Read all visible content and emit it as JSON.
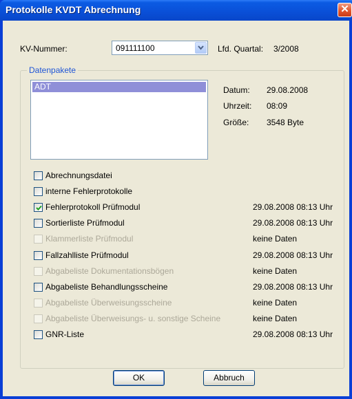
{
  "window": {
    "title": "Protokolle KVDT Abrechnung",
    "close_symbol": "✕"
  },
  "header": {
    "kv_label": "KV-Nummer:",
    "kv_value": "091111100",
    "quarter_label": "Lfd. Quartal:",
    "quarter_value": "3/2008"
  },
  "group": {
    "legend": "Datenpakete"
  },
  "list": {
    "items": [
      "ADT"
    ]
  },
  "details": {
    "date_label": "Datum:",
    "date_value": "29.08.2008",
    "time_label": "Uhrzeit:",
    "time_value": "08:09",
    "size_label": "Größe:",
    "size_value": "3548 Byte"
  },
  "checkboxes": [
    {
      "label": "Abrechnungsdatei",
      "checked": false,
      "enabled": true,
      "status": ""
    },
    {
      "label": "interne Fehlerprotokolle",
      "checked": false,
      "enabled": true,
      "status": ""
    },
    {
      "label": "Fehlerprotokoll Prüfmodul",
      "checked": true,
      "enabled": true,
      "status": "29.08.2008 08:13 Uhr"
    },
    {
      "label": "Sortierliste Prüfmodul",
      "checked": false,
      "enabled": true,
      "status": "29.08.2008 08:13 Uhr"
    },
    {
      "label": "Klammerliste Prüfmodul",
      "checked": false,
      "enabled": false,
      "status": "keine Daten"
    },
    {
      "label": "Fallzahlliste Prüfmodul",
      "checked": false,
      "enabled": true,
      "status": "29.08.2008 08:13 Uhr"
    },
    {
      "label": "Abgabeliste Dokumentationsbögen",
      "checked": false,
      "enabled": false,
      "status": "keine Daten"
    },
    {
      "label": "Abgabeliste Behandlungsscheine",
      "checked": false,
      "enabled": true,
      "status": "29.08.2008 08:13 Uhr"
    },
    {
      "label": "Abgabeliste Überweisungsscheine",
      "checked": false,
      "enabled": false,
      "status": "keine Daten"
    },
    {
      "label": "Abgabeliste Überweisungs- u. sonstige Scheine",
      "checked": false,
      "enabled": false,
      "status": "keine Daten"
    },
    {
      "label": "GNR-Liste",
      "checked": false,
      "enabled": true,
      "status": "29.08.2008 08:13 Uhr"
    }
  ],
  "buttons": {
    "ok": "OK",
    "cancel": "Abbruch"
  }
}
